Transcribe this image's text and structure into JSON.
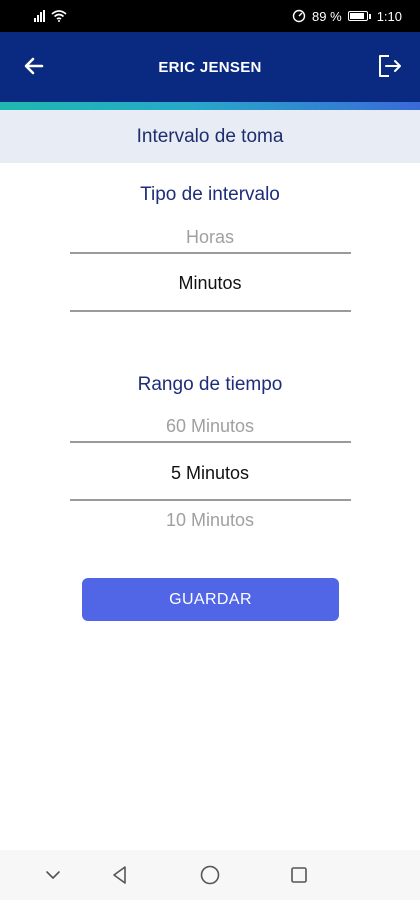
{
  "status_bar": {
    "battery_text": "89 %",
    "time": "1:10"
  },
  "header": {
    "title": "ERIC JENSEN"
  },
  "section": {
    "title": "Intervalo de toma"
  },
  "interval_type": {
    "label": "Tipo de intervalo",
    "options_visible": [
      "Horas",
      "Minutos"
    ],
    "selected": "Minutos"
  },
  "time_range": {
    "label": "Rango de tiempo",
    "options_visible": [
      "60 Minutos",
      "5 Minutos",
      "10 Minutos"
    ],
    "selected": "5 Minutos"
  },
  "actions": {
    "save_label": "GUARDAR"
  },
  "colors": {
    "header_bg": "#0a2a82",
    "accent_button": "#5166e6",
    "label_blue": "#1e2d7a"
  },
  "icons": {
    "back": "arrow-left-icon",
    "logout": "logout-icon",
    "nav": [
      "chevron-down-icon",
      "back-triangle-icon",
      "home-circle-icon",
      "recents-square-icon"
    ]
  }
}
